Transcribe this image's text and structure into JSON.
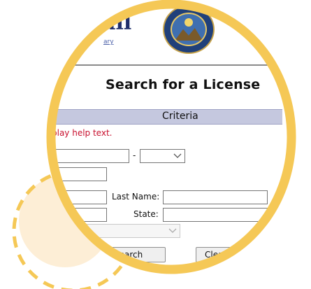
{
  "colors": {
    "frame_yellow": "#f5c856",
    "deco_fill": "#fdeed6",
    "criteria_bar": "#c5c8df",
    "help_red": "#c8102e",
    "title_navy": "#1f2e6b"
  },
  "header": {
    "title_fragment": "ail",
    "link_fragment": "ary",
    "seal_icon": "nevada-state-seal-icon"
  },
  "page": {
    "title": "Search for a License"
  },
  "criteria": {
    "header": "Criteria",
    "help_text": "play help text.",
    "separator": "-",
    "last_name_label": "Last Name:",
    "state_label": "State:"
  },
  "buttons": {
    "search": "Search",
    "clear": "Clear F"
  }
}
